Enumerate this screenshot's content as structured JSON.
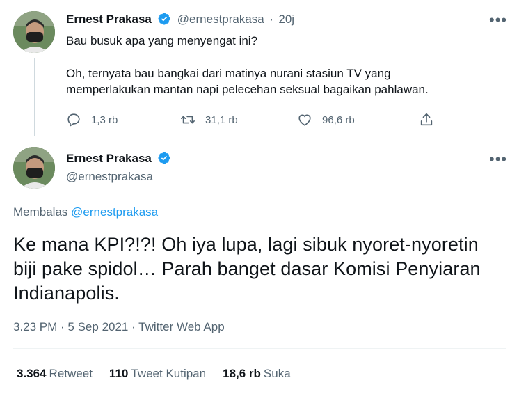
{
  "parent_tweet": {
    "name": "Ernest Prakasa",
    "handle": "@ernestprakasa",
    "separator": "·",
    "time": "20j",
    "more": "•••",
    "text_line1": "Bau busuk apa yang menyengat ini?",
    "text_line2": "Oh, ternyata bau bangkai dari matinya nurani stasiun TV yang",
    "text_line3": "memperlakukan mantan napi pelecehan seksual bagaikan pahlawan.",
    "replies": "1,3 rb",
    "retweets": "31,1 rb",
    "likes": "96,6 rb"
  },
  "main_tweet": {
    "name": "Ernest Prakasa",
    "handle": "@ernestprakasa",
    "more": "•••",
    "reply_prefix": "Membalas",
    "reply_handle": "@ernestprakasa",
    "text_line1": "Ke mana KPI?!?! Oh iya lupa, lagi sibuk nyoret-nyoretin",
    "text_line2": "biji pake spidol… Parah banget dasar Komisi Penyiaran",
    "text_line3": "Indianapolis.",
    "meta": "3.23 PM · 5 Sep 2021 · Twitter Web App",
    "stats": {
      "retweet_count": "3.364",
      "retweet_label": "Retweet",
      "quote_count": "110",
      "quote_label": "Tweet Kutipan",
      "like_count": "18,6 rb",
      "like_label": "Suka"
    }
  },
  "colors": {
    "verified": "#1d9bf0",
    "secondary_text": "#536471",
    "link": "#1d9bf0"
  },
  "icons": [
    "verified-badge-icon",
    "reply-icon",
    "retweet-icon",
    "like-icon",
    "share-icon",
    "more-icon"
  ]
}
